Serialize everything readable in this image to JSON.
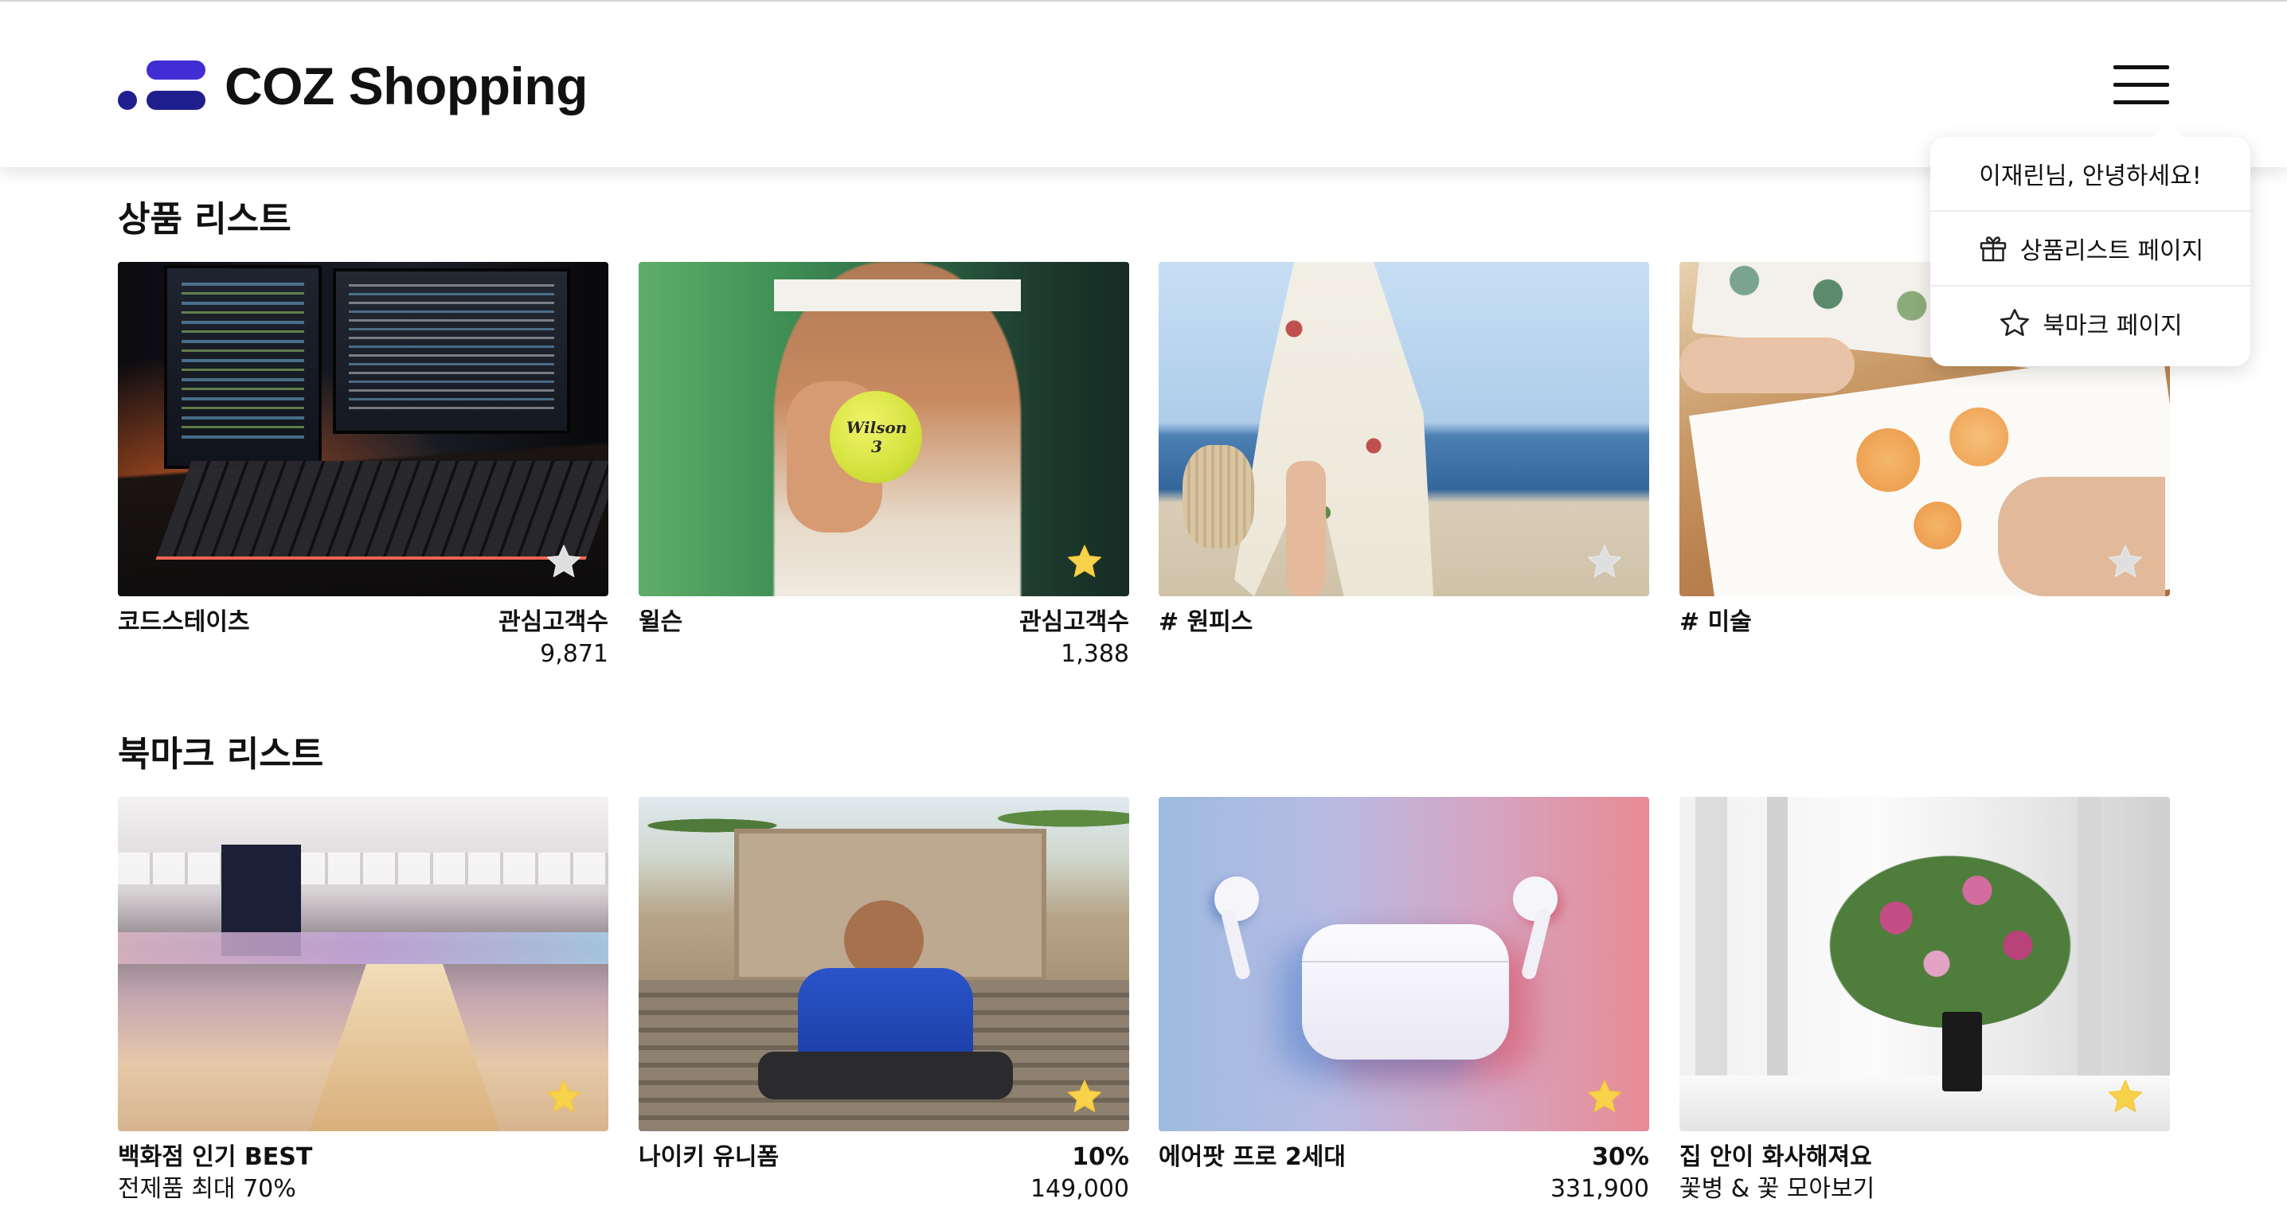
{
  "header": {
    "brand": "COZ Shopping"
  },
  "dropdown": {
    "greeting": "이재린님, 안녕하세요!",
    "items": [
      {
        "label": "상품리스트 페이지",
        "icon": "gift-icon"
      },
      {
        "label": "북마크 페이지",
        "icon": "star-outline-icon"
      }
    ]
  },
  "colors": {
    "brand_dark": "#1f1e8f",
    "brand_accent": "#412dd4",
    "star_on": "#f7d24a",
    "star_off": "#dfdfdf"
  },
  "product_list": {
    "title": "상품 리스트",
    "items": [
      {
        "name": "코드스테이츠",
        "meta_label": "관심고객수",
        "meta_value": "9,871",
        "bookmarked": false
      },
      {
        "name": "윌슨",
        "meta_label": "관심고객수",
        "meta_value": "1,388",
        "bookmarked": true
      },
      {
        "name": "# 원피스",
        "bookmarked": false
      },
      {
        "name": "# 미술",
        "bookmarked": false
      }
    ]
  },
  "bookmark_list": {
    "title": "북마크 리스트",
    "items": [
      {
        "name": "백화점 인기 BEST",
        "sub": "전제품 최대 70%",
        "bookmarked": true
      },
      {
        "name": "나이키 유니폼",
        "discount": "10%",
        "price": "149,000",
        "bookmarked": true
      },
      {
        "name": "에어팟 프로 2세대",
        "discount": "30%",
        "price": "331,900",
        "bookmarked": true
      },
      {
        "name": "집 안이 화사해져요",
        "sub": "꽃병 & 꽃 모아보기",
        "bookmarked": true
      }
    ]
  }
}
